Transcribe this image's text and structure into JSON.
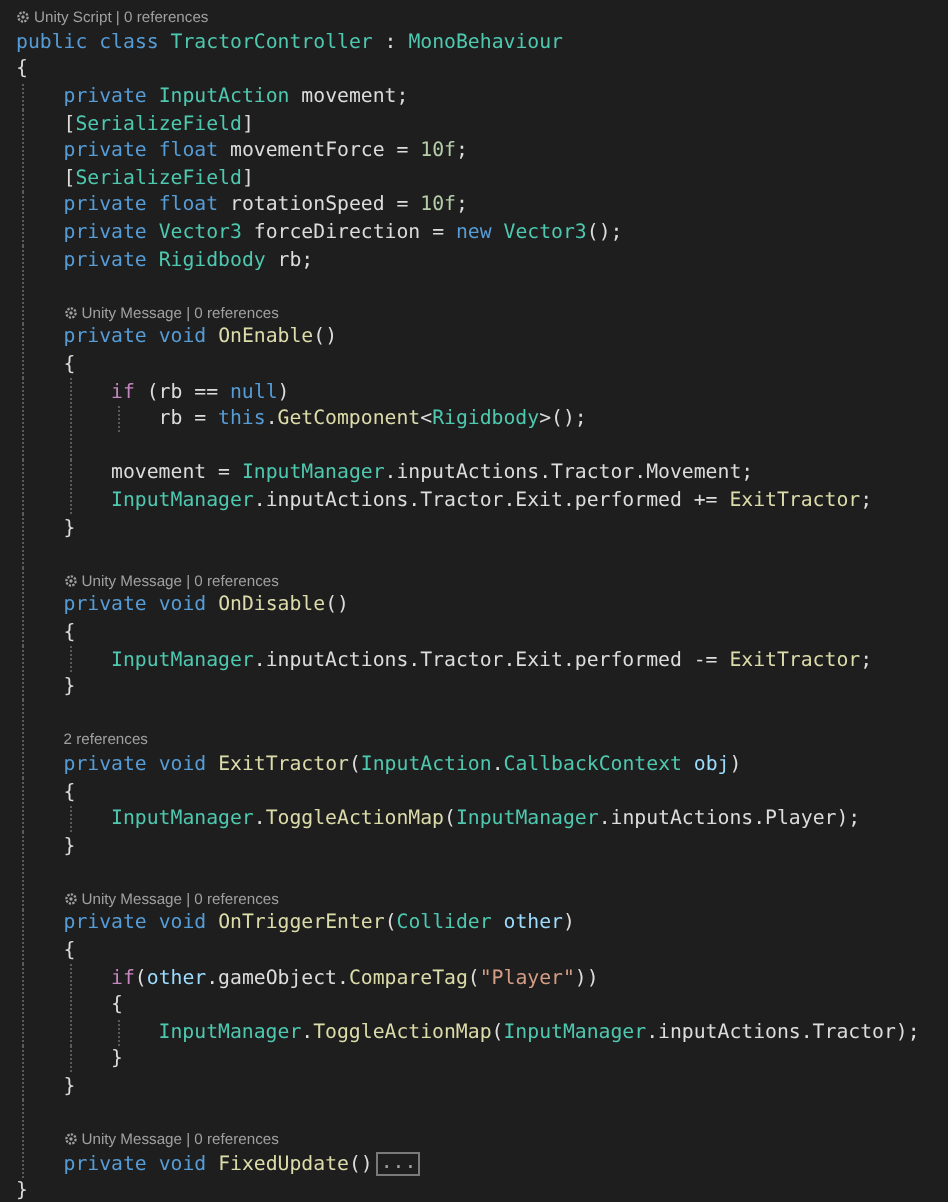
{
  "editor": {
    "lines": [
      {
        "kind": "lens",
        "icon": true,
        "text": "Unity Script | 0 references"
      },
      {
        "kind": "code",
        "tokens": [
          {
            "kind": "kw",
            "t": "public"
          },
          {
            "kind": "kw",
            "t": " class"
          },
          {
            "kind": "type",
            "t": " TractorController"
          },
          {
            "kind": "p",
            "t": " : "
          },
          {
            "kind": "type",
            "t": "MonoBehaviour"
          }
        ]
      },
      {
        "kind": "code",
        "tokens": [
          {
            "kind": "p",
            "t": "{"
          }
        ]
      },
      {
        "kind": "code",
        "tokens": [
          {
            "kind": "kw",
            "t": "    private"
          },
          {
            "kind": "type",
            "t": " InputAction"
          },
          {
            "kind": "p",
            "t": " movement;"
          }
        ]
      },
      {
        "kind": "code",
        "tokens": [
          {
            "kind": "p",
            "t": "    ["
          },
          {
            "kind": "type",
            "t": "SerializeField"
          },
          {
            "kind": "p",
            "t": "]"
          }
        ]
      },
      {
        "kind": "code",
        "tokens": [
          {
            "kind": "kw",
            "t": "    private"
          },
          {
            "kind": "kw",
            "t": " float"
          },
          {
            "kind": "p",
            "t": " movementForce = "
          },
          {
            "kind": "num",
            "t": "10f"
          },
          {
            "kind": "p",
            "t": ";"
          }
        ]
      },
      {
        "kind": "code",
        "tokens": [
          {
            "kind": "p",
            "t": "    ["
          },
          {
            "kind": "type",
            "t": "SerializeField"
          },
          {
            "kind": "p",
            "t": "]"
          }
        ]
      },
      {
        "kind": "code",
        "tokens": [
          {
            "kind": "kw",
            "t": "    private"
          },
          {
            "kind": "kw",
            "t": " float"
          },
          {
            "kind": "p",
            "t": " rotationSpeed = "
          },
          {
            "kind": "num",
            "t": "10f"
          },
          {
            "kind": "p",
            "t": ";"
          }
        ]
      },
      {
        "kind": "code",
        "tokens": [
          {
            "kind": "kw",
            "t": "    private"
          },
          {
            "kind": "type",
            "t": " Vector3"
          },
          {
            "kind": "p",
            "t": " forceDirection = "
          },
          {
            "kind": "kw",
            "t": "new"
          },
          {
            "kind": "type",
            "t": " Vector3"
          },
          {
            "kind": "p",
            "t": "();"
          }
        ]
      },
      {
        "kind": "code",
        "tokens": [
          {
            "kind": "kw",
            "t": "    private"
          },
          {
            "kind": "type",
            "t": " Rigidbody"
          },
          {
            "kind": "p",
            "t": " rb;"
          }
        ]
      },
      {
        "kind": "blank"
      },
      {
        "kind": "lens",
        "icon": true,
        "text": "Unity Message | 0 references"
      },
      {
        "kind": "code",
        "tokens": [
          {
            "kind": "kw",
            "t": "    private"
          },
          {
            "kind": "kw",
            "t": " void"
          },
          {
            "kind": "method",
            "t": " OnEnable"
          },
          {
            "kind": "p",
            "t": "()"
          }
        ]
      },
      {
        "kind": "code",
        "tokens": [
          {
            "kind": "p",
            "t": "    {"
          }
        ]
      },
      {
        "kind": "code",
        "tokens": [
          {
            "kind": "ctl",
            "t": "        if"
          },
          {
            "kind": "p",
            "t": " (rb == "
          },
          {
            "kind": "kw",
            "t": "null"
          },
          {
            "kind": "p",
            "t": ")"
          }
        ]
      },
      {
        "kind": "code",
        "tokens": [
          {
            "kind": "p",
            "t": "            rb = "
          },
          {
            "kind": "kw",
            "t": "this"
          },
          {
            "kind": "p",
            "t": "."
          },
          {
            "kind": "method",
            "t": "GetComponent"
          },
          {
            "kind": "p",
            "t": "<"
          },
          {
            "kind": "type",
            "t": "Rigidbody"
          },
          {
            "kind": "p",
            "t": ">();"
          }
        ]
      },
      {
        "kind": "blank"
      },
      {
        "kind": "code",
        "tokens": [
          {
            "kind": "p",
            "t": "        movement = "
          },
          {
            "kind": "type",
            "t": "InputManager"
          },
          {
            "kind": "p",
            "t": ".inputActions.Tractor.Movement;"
          }
        ]
      },
      {
        "kind": "code",
        "tokens": [
          {
            "kind": "type",
            "t": "        InputManager"
          },
          {
            "kind": "p",
            "t": ".inputActions.Tractor.Exit.performed += "
          },
          {
            "kind": "method",
            "t": "ExitTractor"
          },
          {
            "kind": "p",
            "t": ";"
          }
        ]
      },
      {
        "kind": "code",
        "tokens": [
          {
            "kind": "p",
            "t": "    }"
          }
        ]
      },
      {
        "kind": "blank"
      },
      {
        "kind": "lens",
        "icon": true,
        "text": "Unity Message | 0 references"
      },
      {
        "kind": "code",
        "tokens": [
          {
            "kind": "kw",
            "t": "    private"
          },
          {
            "kind": "kw",
            "t": " void"
          },
          {
            "kind": "method",
            "t": " OnDisable"
          },
          {
            "kind": "p",
            "t": "()"
          }
        ]
      },
      {
        "kind": "code",
        "tokens": [
          {
            "kind": "p",
            "t": "    {"
          }
        ]
      },
      {
        "kind": "code",
        "tokens": [
          {
            "kind": "type",
            "t": "        InputManager"
          },
          {
            "kind": "p",
            "t": ".inputActions.Tractor.Exit.performed -= "
          },
          {
            "kind": "method",
            "t": "ExitTractor"
          },
          {
            "kind": "p",
            "t": ";"
          }
        ]
      },
      {
        "kind": "code",
        "tokens": [
          {
            "kind": "p",
            "t": "    }"
          }
        ]
      },
      {
        "kind": "blank"
      },
      {
        "kind": "lens",
        "icon": false,
        "text": "2 references"
      },
      {
        "kind": "code",
        "tokens": [
          {
            "kind": "kw",
            "t": "    private"
          },
          {
            "kind": "kw",
            "t": " void"
          },
          {
            "kind": "method",
            "t": " ExitTractor"
          },
          {
            "kind": "p",
            "t": "("
          },
          {
            "kind": "type",
            "t": "InputAction"
          },
          {
            "kind": "p",
            "t": "."
          },
          {
            "kind": "type",
            "t": "CallbackContext"
          },
          {
            "kind": "param",
            "t": " obj"
          },
          {
            "kind": "p",
            "t": ")"
          }
        ]
      },
      {
        "kind": "code",
        "tokens": [
          {
            "kind": "p",
            "t": "    {"
          }
        ]
      },
      {
        "kind": "code",
        "tokens": [
          {
            "kind": "type",
            "t": "        InputManager"
          },
          {
            "kind": "p",
            "t": "."
          },
          {
            "kind": "method",
            "t": "ToggleActionMap"
          },
          {
            "kind": "p",
            "t": "("
          },
          {
            "kind": "type",
            "t": "InputManager"
          },
          {
            "kind": "p",
            "t": ".inputActions.Player);"
          }
        ]
      },
      {
        "kind": "code",
        "tokens": [
          {
            "kind": "p",
            "t": "    }"
          }
        ]
      },
      {
        "kind": "blank"
      },
      {
        "kind": "lens",
        "icon": true,
        "text": "Unity Message | 0 references"
      },
      {
        "kind": "code",
        "tokens": [
          {
            "kind": "kw",
            "t": "    private"
          },
          {
            "kind": "kw",
            "t": " void"
          },
          {
            "kind": "method",
            "t": " OnTriggerEnter"
          },
          {
            "kind": "p",
            "t": "("
          },
          {
            "kind": "type",
            "t": "Collider"
          },
          {
            "kind": "param",
            "t": " other"
          },
          {
            "kind": "p",
            "t": ")"
          }
        ]
      },
      {
        "kind": "code",
        "tokens": [
          {
            "kind": "p",
            "t": "    {"
          }
        ]
      },
      {
        "kind": "code",
        "tokens": [
          {
            "kind": "ctl",
            "t": "        if"
          },
          {
            "kind": "p",
            "t": "("
          },
          {
            "kind": "param",
            "t": "other"
          },
          {
            "kind": "p",
            "t": ".gameObject."
          },
          {
            "kind": "method",
            "t": "CompareTag"
          },
          {
            "kind": "p",
            "t": "("
          },
          {
            "kind": "str",
            "t": "\"Player\""
          },
          {
            "kind": "p",
            "t": "))"
          }
        ]
      },
      {
        "kind": "code",
        "tokens": [
          {
            "kind": "p",
            "t": "        {"
          }
        ]
      },
      {
        "kind": "code",
        "tokens": [
          {
            "kind": "type",
            "t": "            InputManager"
          },
          {
            "kind": "p",
            "t": "."
          },
          {
            "kind": "method",
            "t": "ToggleActionMap"
          },
          {
            "kind": "p",
            "t": "("
          },
          {
            "kind": "type",
            "t": "InputManager"
          },
          {
            "kind": "p",
            "t": ".inputActions.Tractor);"
          }
        ]
      },
      {
        "kind": "code",
        "tokens": [
          {
            "kind": "p",
            "t": "        }"
          }
        ]
      },
      {
        "kind": "code",
        "tokens": [
          {
            "kind": "p",
            "t": "    }"
          }
        ]
      },
      {
        "kind": "blank"
      },
      {
        "kind": "lens",
        "icon": true,
        "text": "Unity Message | 0 references"
      },
      {
        "kind": "code",
        "tokens": [
          {
            "kind": "kw",
            "t": "    private"
          },
          {
            "kind": "kw",
            "t": " void"
          },
          {
            "kind": "method",
            "t": " FixedUpdate"
          },
          {
            "kind": "p",
            "t": "()"
          }
        ],
        "fold": "..."
      },
      {
        "kind": "code",
        "tokens": [
          {
            "kind": "p",
            "t": "}"
          }
        ]
      }
    ]
  }
}
